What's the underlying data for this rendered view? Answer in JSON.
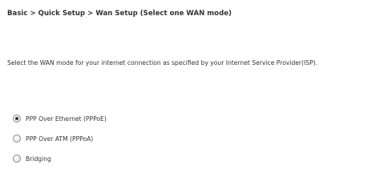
{
  "breadcrumb": {
    "items": [
      "Basic",
      "Quick Setup",
      "Wan Setup (Select one WAN mode)"
    ],
    "separator": ">"
  },
  "instruction": "Select the WAN mode for your internet connection as specified by your Internet Service Provider(ISP).",
  "wan_modes": {
    "selected_index": 0,
    "options": [
      {
        "label": "PPP Over Ethernet (PPPoE)",
        "checked": true
      },
      {
        "label": "PPP Over ATM (PPPoA)",
        "checked": false
      },
      {
        "label": "Bridging",
        "checked": false
      }
    ]
  }
}
